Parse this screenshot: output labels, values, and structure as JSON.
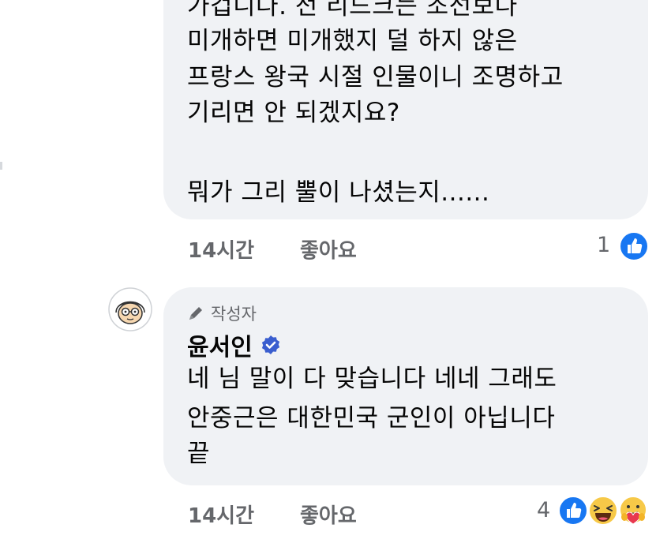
{
  "comment_1": {
    "lines": [
      "가겁니다. 전 리드크는 조선보다",
      "미개하면 미개했지 덜 하지 않은",
      "프랑스 왕국 시절 인물이니 조명하고",
      "기리면 안 되겠지요?",
      "",
      "뭐가 그리 뿔이 나셨는지......"
    ],
    "time": "14시간",
    "like_label": "좋아요",
    "reaction_count": "1"
  },
  "comment_2": {
    "author_badge": "작성자",
    "author_name": "윤서인",
    "lines": [
      "네 님 말이 다 맞습니다 네네 그래도",
      "안중근은 대한민국 군인이 아닙니다",
      "끝"
    ],
    "time": "14시간",
    "like_label": "좋아요",
    "reaction_count": "4"
  },
  "colors": {
    "bubble": "#f0f2f5",
    "meta_text": "#65676b",
    "like_blue": "#1877f2",
    "verified_blue": "#3a5ecf"
  },
  "icons": [
    "pencil-icon",
    "verified-badge-icon",
    "like-reaction-icon",
    "haha-reaction-icon",
    "care-reaction-icon"
  ]
}
